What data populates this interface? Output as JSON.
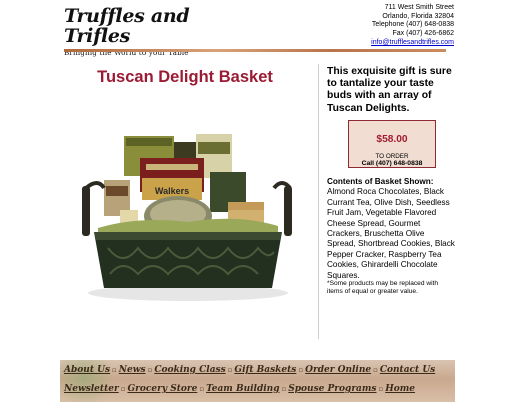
{
  "header": {
    "logo_title": "Truffles and Trifles",
    "logo_tagline": "Bringing the World to your Table",
    "address_lines": [
      "711 West Smith Street",
      "Orlando, Florida 32804",
      "Telephone (407) 648-0838",
      "Fax (407) 426-6862"
    ],
    "email": "info@trufflesandtrifles.com"
  },
  "product": {
    "title": "Tuscan Delight Basket",
    "intro": "This exquisite gift is sure to tantalize your taste buds with an array of Tuscan Delights.",
    "price": "$58.00",
    "to_order": "TO ORDER",
    "call": "Call (407) 648-0838",
    "contents_head": "Contents of Basket Shown:",
    "contents": "Almond Roca Chocolates, Black Currant Tea, Olive Dish, Seedless Fruit Jam, Vegetable Flavored Cheese Spread, Gourmet Crackers, Bruschetta Olive Spread, Shortbread Cookies, Black Pepper Cracker, Raspberry Tea Cookies, Ghirardelli Chocolate Squares.",
    "note": "*Some products may be replaced with items of equal or greater value.",
    "image_labels": [
      "Walkers"
    ]
  },
  "nav": {
    "row1": [
      "About Us",
      "News",
      "Cooking Class",
      "Gift Baskets",
      "Order Online",
      "Contact Us"
    ],
    "row2": [
      "Newsletter",
      "Grocery Store",
      "Team Building",
      "Spouse Programs",
      "Home"
    ]
  },
  "colors": {
    "title": "#9b1b34",
    "price": "#a21d30",
    "link": "#0000cc"
  }
}
